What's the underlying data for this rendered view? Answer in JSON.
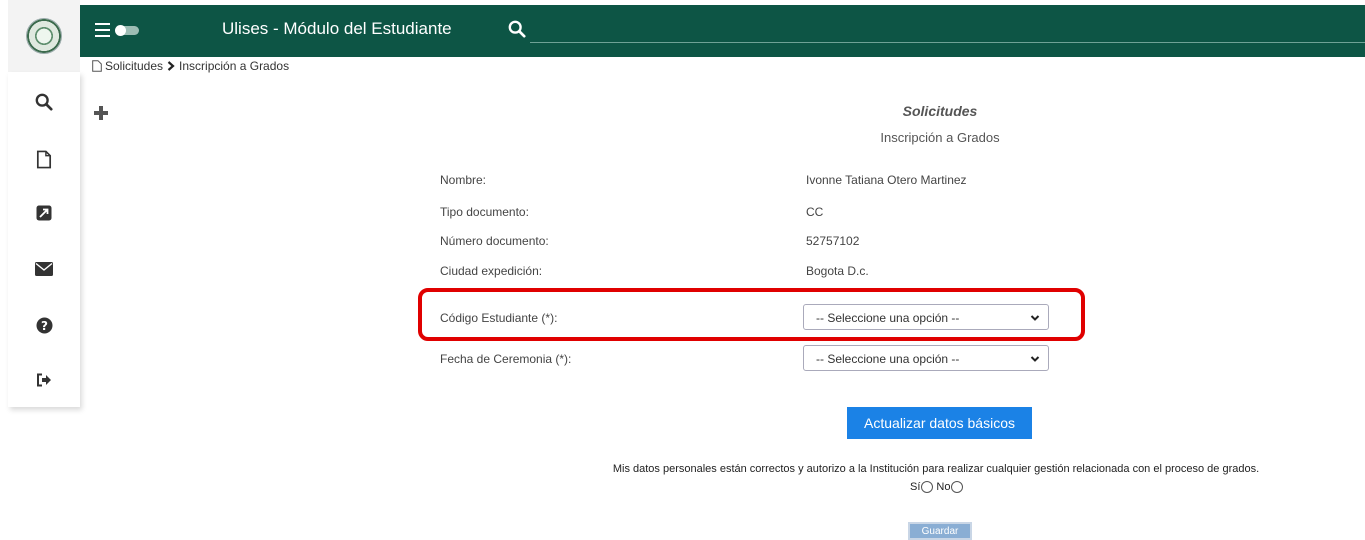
{
  "header": {
    "app_title": "Ulises - Módulo del Estudiante",
    "brand_color": "#0d5545"
  },
  "breadcrumb": {
    "items": [
      "Solicitudes",
      "Inscripción a Grados"
    ]
  },
  "sidebar": {
    "icons": [
      "search-icon",
      "document-icon",
      "external-link-icon",
      "envelope-icon",
      "help-icon",
      "logout-icon"
    ]
  },
  "page": {
    "title": "Solicitudes",
    "subtitle": "Inscripción a Grados"
  },
  "student": {
    "fields": [
      {
        "label": "Nombre:",
        "value": "Ivonne Tatiana Otero Martinez"
      },
      {
        "label": "Tipo documento:",
        "value": "CC"
      },
      {
        "label": "Número documento:",
        "value": "52757102"
      },
      {
        "label": "Ciudad expedición:",
        "value": "Bogota D.c."
      }
    ]
  },
  "form": {
    "codigo_label": "Código Estudiante (*):",
    "codigo_selected": "-- Seleccione una opción --",
    "fecha_label": "Fecha de Ceremonia (*):",
    "fecha_selected": "-- Seleccione una opción --",
    "update_button": "Actualizar datos básicos",
    "consent_text": "Mis datos personales están correctos y autorizo a la Institución para realizar cualquier gestión relacionada con el proceso de grados.",
    "yes_label": "Sí",
    "no_label": "No",
    "save_button": "Guardar",
    "accent_color": "#1b82e6",
    "highlight_color": "#e00000"
  }
}
